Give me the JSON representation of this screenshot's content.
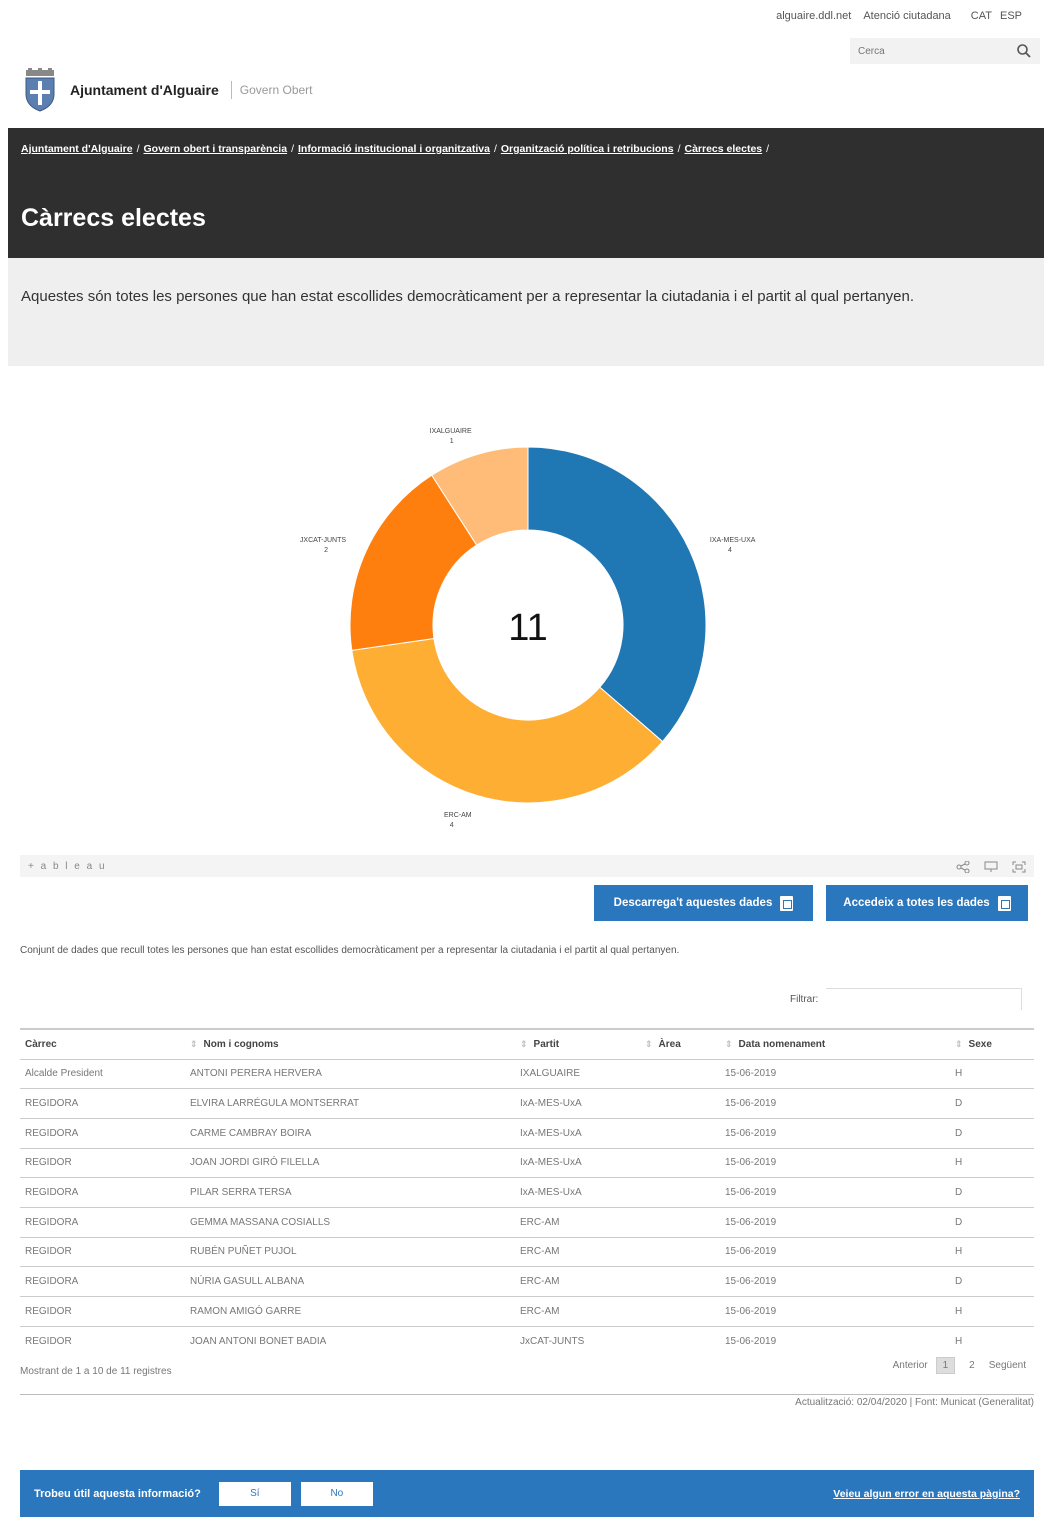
{
  "top_bar": {
    "links": [
      "alguaire.ddl.net",
      "Atenció ciutadana"
    ],
    "languages": [
      "CAT",
      "ESP"
    ],
    "search_placeholder": "Cerca",
    "search_icon": "magnifier"
  },
  "brand": {
    "org_name": "Ajuntament d'Alguaire",
    "subtitle": "Govern Obert",
    "logo_icon": "coat-of-arms"
  },
  "breadcrumb": [
    "Ajuntament d'Alguaire",
    "Govern obert i transparència",
    "Informació institucional i organitzativa",
    "Organització política i retribucions",
    "Càrrecs electes"
  ],
  "page_title": "Càrrecs electes",
  "intro_text": "Aquestes són totes les persones que han estat escollides democràticament per a representar la ciutadania i el partit al qual pertanyen.",
  "chart_data": {
    "type": "pie",
    "donut": true,
    "center_label": "11",
    "slices": [
      {
        "label": "IXA-MES-UXA",
        "value": 4,
        "color": "#1f77b4"
      },
      {
        "label": "ERC-AM",
        "value": 4,
        "color": "#ffae34"
      },
      {
        "label": "JXCAT-JUNTS",
        "value": 2,
        "color": "#ff7f0e"
      },
      {
        "label": "IXALGUAIRE",
        "value": 1,
        "color": "#ffbb78"
      }
    ]
  },
  "tableau": {
    "logo": "+ a b l e a u",
    "icons": [
      "share-icon",
      "comment-icon",
      "fullscreen-icon"
    ]
  },
  "buttons": {
    "download": "Descarrega't aquestes dades",
    "access_all": "Accedeix a totes les dades"
  },
  "dataset_description": "Conjunt de dades que recull totes les persones que han estat escollides democràticament per a representar la ciutadania i el partit al qual pertanyen.",
  "filter_label": "Filtrar:",
  "table": {
    "columns": [
      "Càrrec",
      "Nom i cognoms",
      "Partit",
      "Àrea",
      "Data nomenament",
      "Sexe"
    ],
    "rows": [
      [
        "Alcalde President",
        "ANTONI PERERA HERVERA",
        "IXALGUAIRE",
        "",
        "15-06-2019",
        "H"
      ],
      [
        "REGIDORA",
        "ELVIRA LARRÉGULA MONTSERRAT",
        "IxA-MES-UxA",
        "",
        "15-06-2019",
        "D"
      ],
      [
        "REGIDORA",
        "CARME CAMBRAY BOIRA",
        "IxA-MES-UxA",
        "",
        "15-06-2019",
        "D"
      ],
      [
        "REGIDOR",
        "JOAN JORDI GIRÓ FILELLA",
        "IxA-MES-UxA",
        "",
        "15-06-2019",
        "H"
      ],
      [
        "REGIDORA",
        "PILAR SERRA TERSA",
        "IxA-MES-UxA",
        "",
        "15-06-2019",
        "D"
      ],
      [
        "REGIDORA",
        "GEMMA MASSANA COSIALLS",
        "ERC-AM",
        "",
        "15-06-2019",
        "D"
      ],
      [
        "REGIDOR",
        "RUBÉN PUÑET PUJOL",
        "ERC-AM",
        "",
        "15-06-2019",
        "H"
      ],
      [
        "REGIDORA",
        "NÚRIA GASULL ALBANA",
        "ERC-AM",
        "",
        "15-06-2019",
        "D"
      ],
      [
        "REGIDOR",
        "RAMON AMIGÓ GARRE",
        "ERC-AM",
        "",
        "15-06-2019",
        "H"
      ],
      [
        "REGIDOR",
        "JOAN ANTONI BONET BADIA",
        "JxCAT-JUNTS",
        "",
        "15-06-2019",
        "H"
      ]
    ]
  },
  "showing_text": "Mostrant de 1 a 10 de 11 registres",
  "pagination": {
    "previous": "Anterior",
    "pages": [
      "1",
      "2"
    ],
    "current": "1",
    "next": "Següent"
  },
  "update_text": "Actualització: 02/04/2020 | Font: Municat (Generalitat)",
  "feedback": {
    "question": "Trobeu útil aquesta informació?",
    "yes": "Sí",
    "no": "No",
    "error_link": "Veieu algun error en aquesta pàgina?"
  }
}
